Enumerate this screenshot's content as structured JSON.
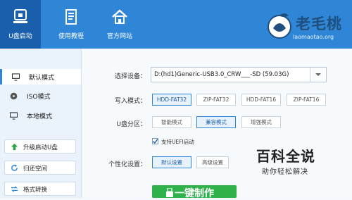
{
  "nav": {
    "items": [
      {
        "label": "U盘启动",
        "icon": "usb-drive-icon"
      },
      {
        "label": "使用教程",
        "icon": "book-icon"
      },
      {
        "label": "官方网站",
        "icon": "home-icon"
      }
    ]
  },
  "logo": {
    "name": "老毛桃",
    "url": "laomaotao.org"
  },
  "sidebar": {
    "modes": [
      {
        "label": "默认模式",
        "icon": "monitor-icon"
      },
      {
        "label": "ISO模式",
        "icon": "disc-icon"
      },
      {
        "label": "本地模式",
        "icon": "monitor-icon"
      }
    ],
    "buttons": [
      {
        "label": "升级启动U盘",
        "icon": "upload-arrow-icon"
      },
      {
        "label": "归还空间",
        "icon": "refresh-icon"
      },
      {
        "label": "格式转换",
        "icon": "convert-icon"
      }
    ]
  },
  "form": {
    "device_label": "选择设备：",
    "device_value": "D:(hd1)Generic-USB3.0_CRW___-SD (59.03G)",
    "write_mode_label": "写入模式：",
    "write_modes": [
      "HDD-FAT32",
      "ZIP-FAT32",
      "HDD-FAT16",
      "ZIP-FAT16"
    ],
    "partition_label": "U盘分区：",
    "partitions": [
      "智能模式",
      "兼容模式",
      "增强模式"
    ],
    "uefi_label": "支持UEFI启动",
    "personalize_label": "个性化设置：",
    "personalize_options": [
      "默认设置",
      "高级设置"
    ],
    "go_label": "一键制作"
  },
  "watermark": {
    "title": "百科全说",
    "subtitle": "助你轻松解决"
  },
  "colors": {
    "header": "#2f86d6",
    "accent": "#2fb24a"
  }
}
